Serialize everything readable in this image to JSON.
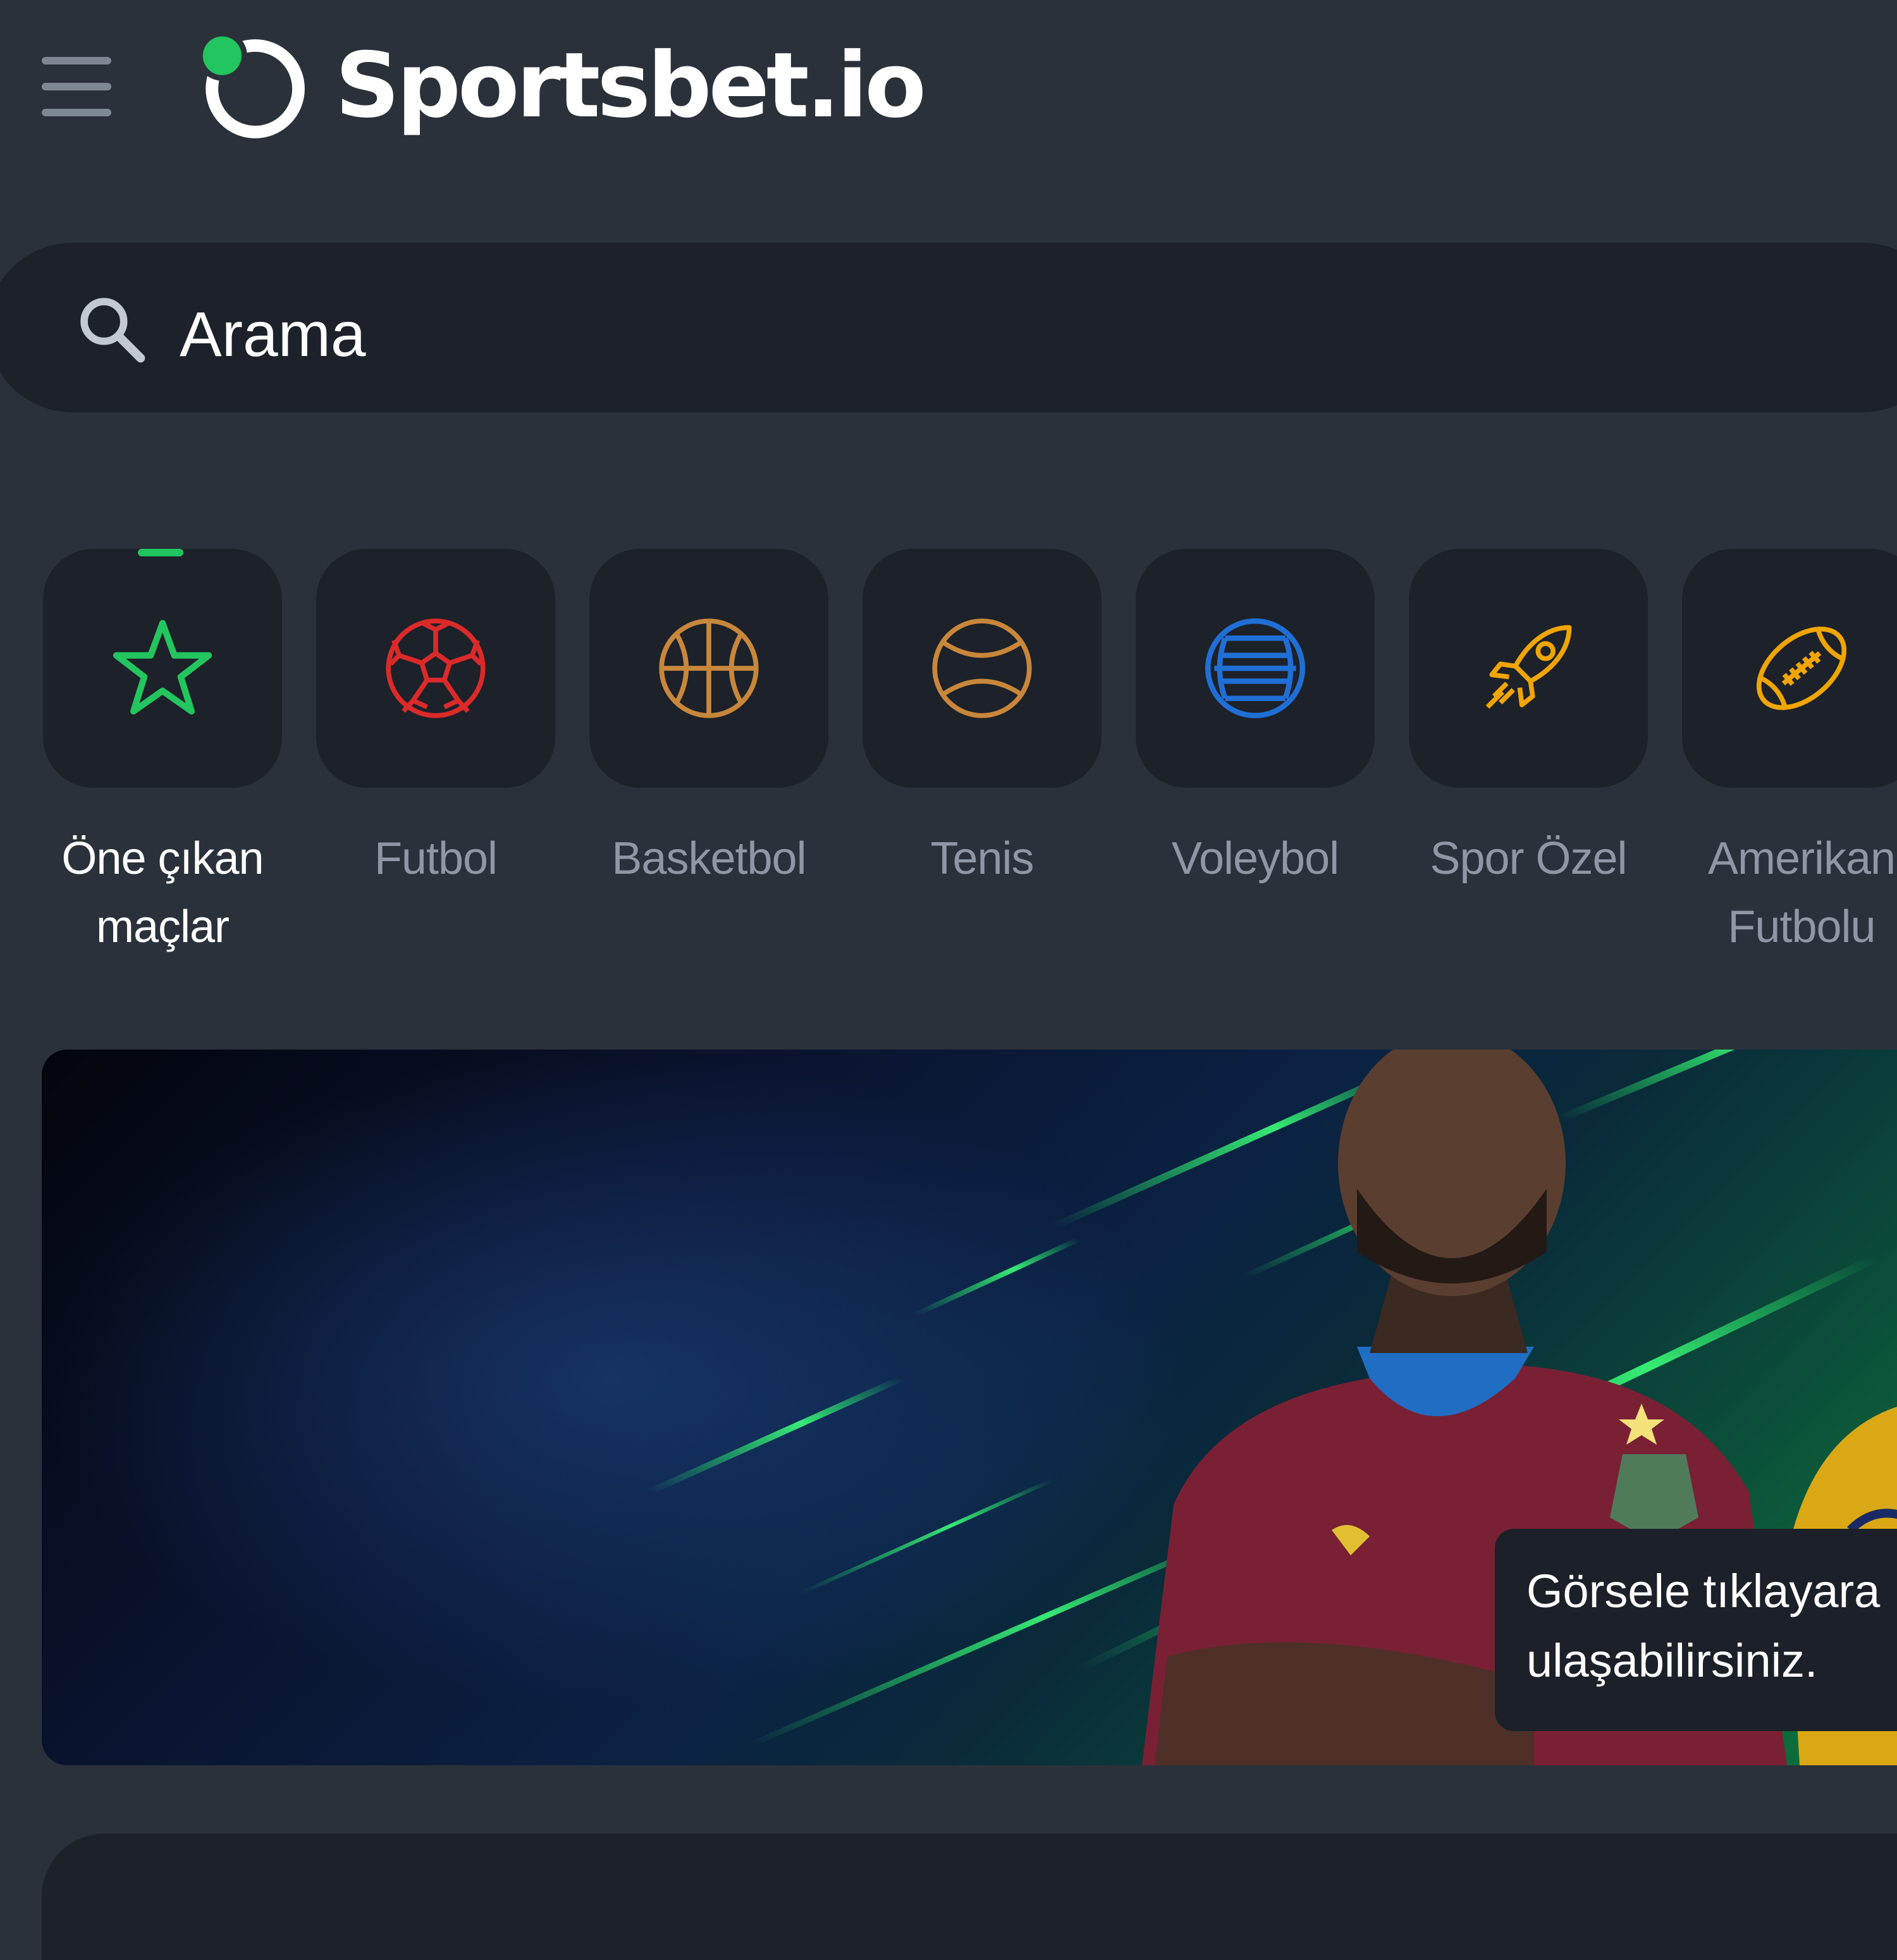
{
  "header": {
    "menu_icon": "hamburger-menu-icon",
    "logo_text": "Sportsbet.io",
    "logo_accent_color": "#22c55e"
  },
  "search": {
    "placeholder": "Arama",
    "icon": "search-icon"
  },
  "categories": [
    {
      "label": "Öne çıkan maçlar",
      "icon": "star-icon",
      "color": "#22c55e",
      "active": true
    },
    {
      "label": "Futbol",
      "icon": "soccer-ball-icon",
      "color": "#dc2a2a"
    },
    {
      "label": "Basketbol",
      "icon": "basketball-icon",
      "color": "#c8873a"
    },
    {
      "label": "Tenis",
      "icon": "tennis-ball-icon",
      "color": "#c8873a"
    },
    {
      "label": "Voleybol",
      "icon": "volleyball-icon",
      "color": "#1f6fd6"
    },
    {
      "label": "Spor Özel",
      "icon": "rocket-icon",
      "color": "#f0a500"
    },
    {
      "label": "Amerikan Futbolu",
      "icon": "american-football-icon",
      "color": "#f0a500"
    }
  ],
  "banner": {
    "tooltip_line1": "Görsele tıklayara",
    "tooltip_line2": "ulaşabilirsiniz."
  }
}
